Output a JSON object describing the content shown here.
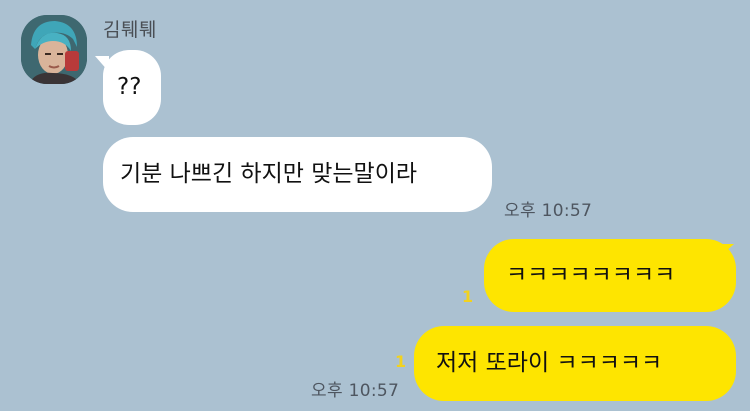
{
  "chat": {
    "sender_name": "김퉤퉤",
    "incoming": [
      {
        "text": "??"
      },
      {
        "text": "기분 나쁘긴 하지만 맞는말이라",
        "time": "오후 10:57"
      }
    ],
    "outgoing": [
      {
        "text": "ㅋㅋㅋㅋㅋㅋㅋㅋ",
        "unread": "1"
      },
      {
        "text": "저저 또라이 ㅋㅋㅋㅋㅋ",
        "unread": "1",
        "time": "오후 10:57"
      }
    ]
  },
  "colors": {
    "background": "#abc1d1",
    "incoming_bubble": "#ffffff",
    "outgoing_bubble": "#fee500",
    "unread_count": "#f2d21e"
  },
  "icons": {
    "avatar": "profile-photo"
  }
}
